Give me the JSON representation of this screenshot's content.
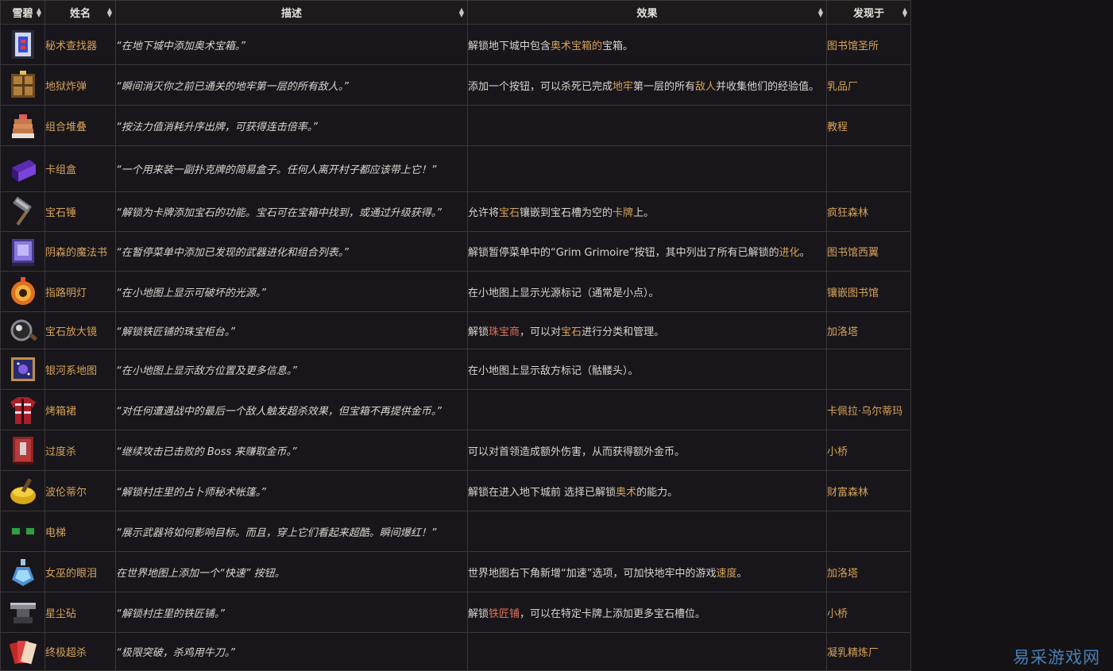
{
  "headers": {
    "icon": "雪碧",
    "name": "姓名",
    "desc": "描述",
    "effect": "效果",
    "found": "发现于"
  },
  "rows": [
    {
      "icon": "blue-card-icon",
      "name": "秘术查找器",
      "desc": "“在地下城中添加奥术宝箱。”",
      "effect": [
        {
          "t": "解锁地下城中包含"
        },
        {
          "t": "奥术宝箱的",
          "c": "hl"
        },
        {
          "t": "宝箱。"
        }
      ],
      "found": "图书馆圣所"
    },
    {
      "icon": "crate-bomb-icon",
      "name": "地狱炸弹",
      "desc": "“瞬间消灭你之前已通关的地牢第一层的所有敌人。”",
      "effect": [
        {
          "t": "添加一个按钮，可以杀死已完成"
        },
        {
          "t": "地牢",
          "c": "hl"
        },
        {
          "t": "第一层的所有"
        },
        {
          "t": "敌人",
          "c": "hl"
        },
        {
          "t": "并收集他们的经验值。"
        }
      ],
      "found": "乳品厂"
    },
    {
      "icon": "pancake-stack-icon",
      "name": "组合堆叠",
      "desc": "“按法力值消耗升序出牌，可获得连击倍率。”",
      "effect": [],
      "found": "教程"
    },
    {
      "icon": "card-box-icon",
      "name": "卡组盒",
      "desc": "“一个用来装一副扑克牌的简易盒子。任何人离开村子都应该带上它！”",
      "effect": [],
      "found": ""
    },
    {
      "icon": "gem-hammer-icon",
      "name": "宝石锤",
      "desc": "“解锁为卡牌添加宝石的功能。宝石可在宝箱中找到，或通过升级获得。”",
      "effect": [
        {
          "t": "允许将"
        },
        {
          "t": "宝石",
          "c": "hl"
        },
        {
          "t": "镶嵌到宝石槽为空的"
        },
        {
          "t": "卡牌",
          "c": "hl"
        },
        {
          "t": "上。"
        }
      ],
      "found": "疯狂森林"
    },
    {
      "icon": "grimoire-icon",
      "name": "阴森的魔法书",
      "desc": "“在暂停菜单中添加已发现的武器进化和组合列表。”",
      "effect": [
        {
          "t": "解锁暂停菜单中的“Grim Grimoire”按钮，其中列出了所有已解锁的"
        },
        {
          "t": "进化",
          "c": "hl"
        },
        {
          "t": "。"
        }
      ],
      "found": "图书馆西翼"
    },
    {
      "icon": "beacon-eye-icon",
      "name": "指路明灯",
      "desc": "“在小地图上显示可破坏的光源。”",
      "effect": [
        {
          "t": "在小地图上显示光源标记（通常是小点）。"
        }
      ],
      "found": "镶嵌图书馆"
    },
    {
      "icon": "magnifier-icon",
      "name": "宝石放大镜",
      "desc": "“解锁铁匠铺的珠宝柜台。”",
      "effect": [
        {
          "t": "解锁"
        },
        {
          "t": "珠宝商",
          "c": "hl-red"
        },
        {
          "t": "，可以对"
        },
        {
          "t": "宝石",
          "c": "hl"
        },
        {
          "t": "进行分类和管理。"
        }
      ],
      "found": "加洛塔"
    },
    {
      "icon": "galaxy-map-icon",
      "name": "银河系地图",
      "desc": "“在小地图上显示敌方位置及更多信息。”",
      "effect": [
        {
          "t": "在小地图上显示敌方标记（骷髅头）。"
        }
      ],
      "found": ""
    },
    {
      "icon": "plaid-shirt-icon",
      "name": "烤箱裙",
      "desc": "“对任何遭遇战中的最后一个敌人触发超杀效果，但宝箱不再提供金币。”",
      "effect": [],
      "found": "卡佩拉·乌尔蒂玛"
    },
    {
      "icon": "red-book-icon",
      "name": "过度杀",
      "desc": "“继续攻击已击败的 Boss 来赚取金币。”",
      "effect": [
        {
          "t": "可以对首领造成额外伤害，从而获得额外金币。"
        }
      ],
      "found": "小桥"
    },
    {
      "icon": "gold-pot-icon",
      "name": "波伦蒂尔",
      "desc": "“解锁村庄里的占卜师秘术帐篷。”",
      "effect": [
        {
          "t": "解锁在进入地下城前 选择已解锁"
        },
        {
          "t": "奥术",
          "c": "hl"
        },
        {
          "t": "的能力。"
        }
      ],
      "found": "财富森林"
    },
    {
      "icon": "green-goggles-icon",
      "name": "电梯",
      "desc": "“展示武器将如何影响目标。而且，穿上它们看起来超酷。瞬间爆红！”",
      "effect": [],
      "found": ""
    },
    {
      "icon": "potion-bottle-icon",
      "name": "女巫的眼泪",
      "desc": "在世界地图上添加一个“快速” 按钮。",
      "effect": [
        {
          "t": "世界地图右下角新增“加速”选项，可加快地牢中的游戏"
        },
        {
          "t": "速度",
          "c": "hl"
        },
        {
          "t": "。"
        }
      ],
      "found": "加洛塔"
    },
    {
      "icon": "anvil-icon",
      "name": "星尘砧",
      "desc": "“解锁村庄里的铁匠铺。”",
      "effect": [
        {
          "t": "解锁"
        },
        {
          "t": "铁匠铺",
          "c": "hl-red"
        },
        {
          "t": "，可以在特定卡牌上添加更多宝石槽位。"
        }
      ],
      "found": "小桥"
    },
    {
      "icon": "card-fan-icon",
      "name": "终极超杀",
      "desc": "“极限突破，杀鸡用牛刀。”",
      "effect": [],
      "found": "凝乳精炼厂"
    }
  ],
  "watermark": "易采游戏网"
}
